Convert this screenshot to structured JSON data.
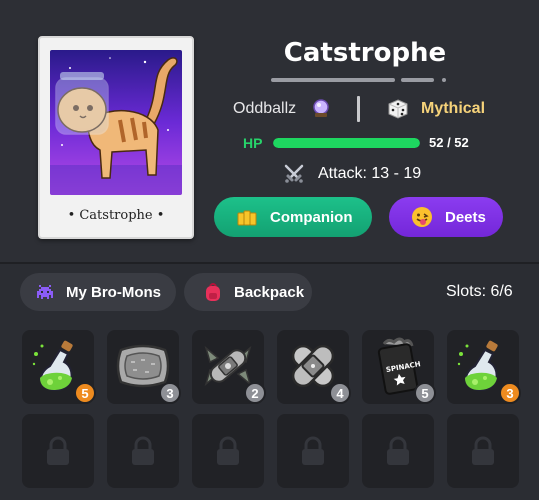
{
  "monster": {
    "name": "Catstrophe",
    "card_caption": "• Catstrophe •",
    "author": "Oddballz",
    "rarity": "Mythical",
    "hp_label": "HP",
    "hp_value": "52 / 52",
    "hp_fraction": 1.0,
    "attack": "Attack: 13 - 19"
  },
  "buttons": {
    "companion": "Companion",
    "deets": "Deets"
  },
  "tabs": {
    "my_bro_mons": "My Bro-Mons",
    "backpack": "Backpack",
    "selected": "Backpack"
  },
  "slots_label": "Slots: 6/6",
  "inventory": [
    {
      "item_icon": "green-potion-icon",
      "count": "5",
      "badge_color": "#ee8b1f"
    },
    {
      "item_icon": "grey-pillow-icon",
      "count": "3",
      "badge_color": "#8e9096"
    },
    {
      "item_icon": "bandage-leaf-icon",
      "count": "2",
      "badge_color": "#8e9096"
    },
    {
      "item_icon": "big-bandage-icon",
      "count": "4",
      "badge_color": "#8e9096"
    },
    {
      "item_icon": "spinach-can-icon",
      "count": "5",
      "badge_color": "#8e9096"
    },
    {
      "item_icon": "green-potion-icon",
      "count": "3",
      "badge_color": "#ee8b1f"
    }
  ],
  "spinach_label": "SPINACH",
  "colors": {
    "background": "#2b2d33",
    "hp_green": "#1ed760",
    "rarity_gold": "#f6d37a",
    "companion_teal": "#1dc18a",
    "deets_purple": "#7f31e6"
  }
}
